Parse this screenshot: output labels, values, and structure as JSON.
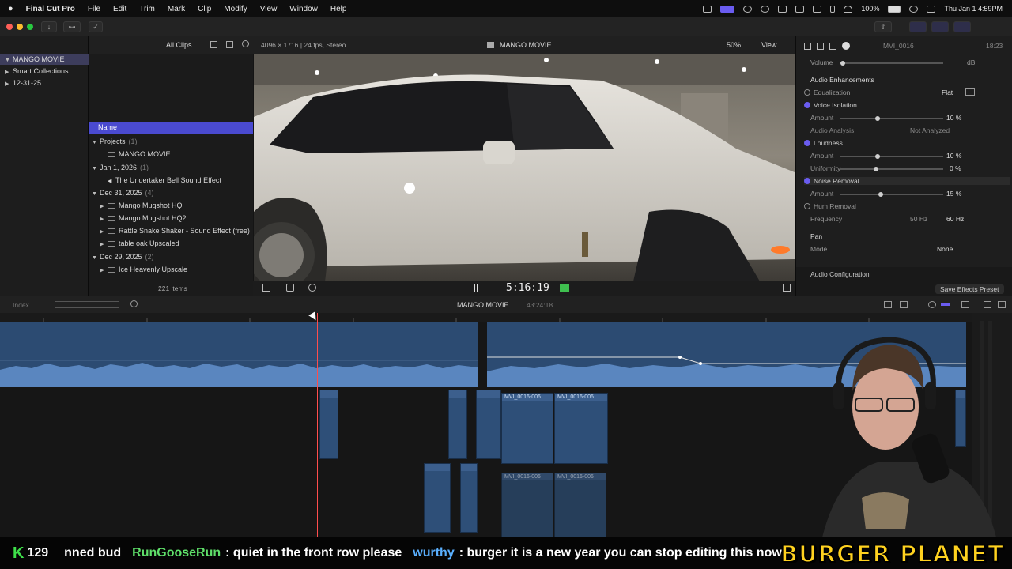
{
  "menubar": {
    "app": "Final Cut Pro",
    "items": [
      "File",
      "Edit",
      "Trim",
      "Mark",
      "Clip",
      "Modify",
      "View",
      "Window",
      "Help"
    ],
    "battery": "100%",
    "datetime": "Thu Jan 1  4:59PM"
  },
  "library": {
    "items": [
      "MANGO MOVIE",
      "Smart Collections",
      "12-31-25"
    ],
    "all_clips": "All Clips",
    "items_count": "221 items"
  },
  "browser": {
    "column_name": "Name",
    "rows": [
      {
        "label": "Projects",
        "count": "(1)",
        "kind": "group"
      },
      {
        "label": "MANGO MOVIE",
        "count": "",
        "kind": "project"
      },
      {
        "label": "Jan 1, 2026",
        "count": "(1)",
        "kind": "group"
      },
      {
        "label": "The Undertaker Bell  Sound Effect",
        "count": "",
        "kind": "audio"
      },
      {
        "label": "Dec 31, 2025",
        "count": "(4)",
        "kind": "group"
      },
      {
        "label": "Mango Mugshot HQ",
        "count": "",
        "kind": "clip"
      },
      {
        "label": "Mango Mugshot HQ2",
        "count": "",
        "kind": "clip"
      },
      {
        "label": "Rattle Snake Shaker - Sound Effect (free)",
        "count": "",
        "kind": "clip"
      },
      {
        "label": "table oak Upscaled",
        "count": "",
        "kind": "clip"
      },
      {
        "label": "Dec 29, 2025",
        "count": "(2)",
        "kind": "group"
      },
      {
        "label": "Ice Heavenly Upscale",
        "count": "",
        "kind": "clip"
      }
    ]
  },
  "viewer": {
    "format": "4096 × 1716 | 24 fps, Stereo",
    "title": "MANGO MOVIE",
    "zoom": "50%",
    "view": "View",
    "timecode": "5:16:19"
  },
  "inspector": {
    "clip_name": "MVI_0016",
    "duration": "18:23",
    "volume_label": "Volume",
    "volume_unit": "dB",
    "section": "Audio Enhancements",
    "equalization": "Equalization",
    "equalization_value": "Flat",
    "voice_isolation": "Voice Isolation",
    "vi_amount_label": "Amount",
    "vi_amount": "10 %",
    "audio_analysis": "Audio Analysis",
    "audio_analysis_value": "Not Analyzed",
    "loudness": "Loudness",
    "loud_amount_label": "Amount",
    "loud_amount": "10 %",
    "uniformity_label": "Uniformity",
    "uniformity": "0 %",
    "noise_removal": "Noise Removal",
    "nr_amount_label": "Amount",
    "nr_amount": "15 %",
    "hum_removal": "Hum Removal",
    "frequency_label": "Frequency",
    "freq_50": "50 Hz",
    "freq_60": "60 Hz",
    "pan": "Pan",
    "mode_label": "Mode",
    "mode_value": "None",
    "audio_config": "Audio Configuration",
    "save_preset": "Save Effects Preset"
  },
  "timeline": {
    "index": "Index",
    "project": "MANGO MOVIE",
    "duration": "43:24:18",
    "clips": {
      "c1": "MVI_0016-006",
      "c2": "MVI_0016-006",
      "c3": "MVI_0016-006",
      "c4": "MVI_0016-006"
    }
  },
  "ticker": {
    "count_icon": "K",
    "count": "129",
    "msg0": "nned bud",
    "user1": "RunGooseRun",
    "msg1": ": quiet in the front row please",
    "user2": "wurthy",
    "msg2": ": burger it is a new year you can stop editing this now",
    "brand": "BURGER PLANET"
  }
}
